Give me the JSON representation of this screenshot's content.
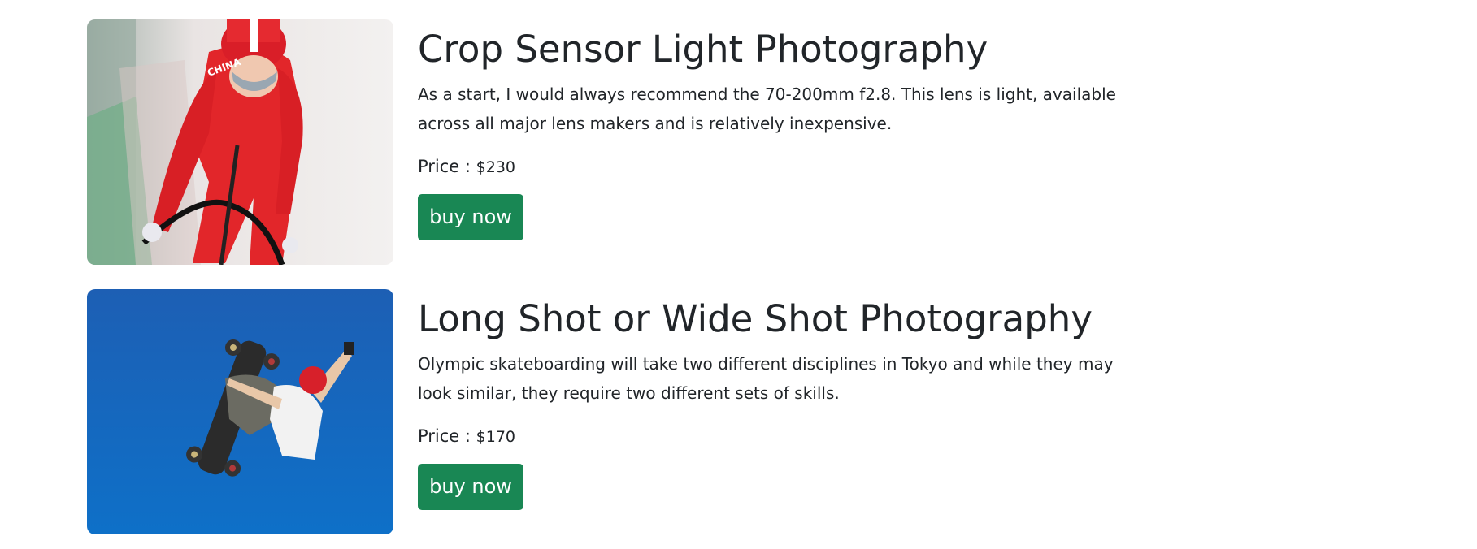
{
  "products": [
    {
      "image": "cyclist-photo",
      "title": "Crop Sensor Light Photography",
      "description": "As a start, I would always recommend the 70-200mm f2.8. This lens is light, available across all major lens makers and is relatively inexpensive.",
      "price_label": "Price : ",
      "price_value": "$230",
      "button_label": "buy now",
      "jersey_text": "CHINA"
    },
    {
      "image": "skateboarder-photo",
      "title": "Long Shot or Wide Shot Photography",
      "description": "Olympic skateboarding will take two different disciplines in Tokyo and while they may look similar, they require two different sets of skills.",
      "price_label": "Price : ",
      "price_value": "$170",
      "button_label": "buy now"
    }
  ],
  "colors": {
    "button": "#198754",
    "text": "#212529"
  }
}
